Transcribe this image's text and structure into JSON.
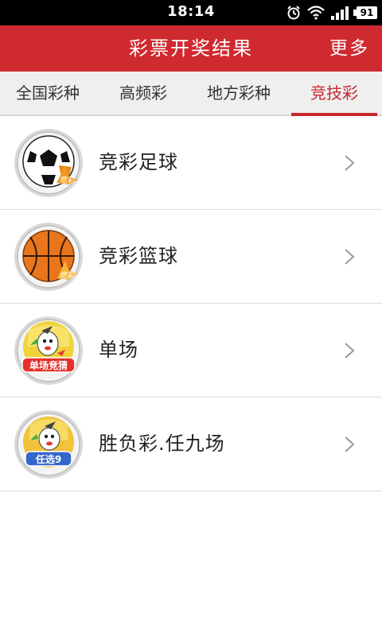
{
  "status": {
    "time": "18:14",
    "battery": "91"
  },
  "header": {
    "title": "彩票开奖结果",
    "more": "更多"
  },
  "tabs": [
    {
      "label": "全国彩种",
      "active": false
    },
    {
      "label": "高频彩",
      "active": false
    },
    {
      "label": "地方彩种",
      "active": false
    },
    {
      "label": "竞技彩",
      "active": true
    }
  ],
  "items": [
    {
      "label": "竞彩足球",
      "icon": "soccer-ball-icon",
      "badge": "竞彩"
    },
    {
      "label": "竞彩篮球",
      "icon": "basketball-icon",
      "badge": "竞彩"
    },
    {
      "label": "单场",
      "icon": "mascot-single-match-icon",
      "badge": "单场竞猜"
    },
    {
      "label": "胜负彩.任九场",
      "icon": "mascot-pick9-icon",
      "badge": "任选9"
    }
  ],
  "colors": {
    "accent": "#cf2a2f",
    "tab_bg": "#efefef",
    "text": "#222222"
  }
}
